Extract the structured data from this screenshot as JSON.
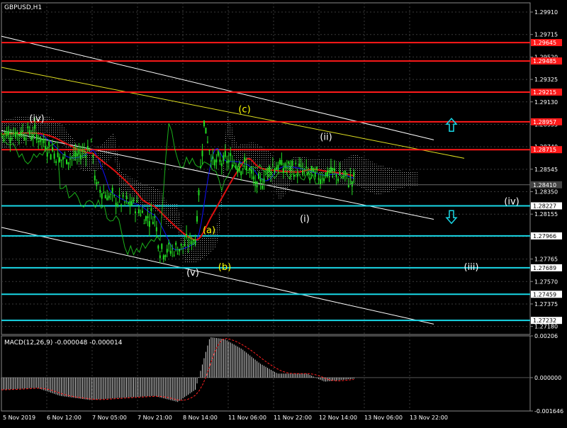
{
  "window": {
    "title": "GBPUSD,H1",
    "macd_label": "MACD(12,26,9) -0.000048 -0.000014"
  },
  "colors": {
    "background": "#000000",
    "grid": "#3a3a3a",
    "price_text": "#ffffff",
    "candle": "#22dd22",
    "resistance_line": "#ff1a1a",
    "support_line": "#19d7e6",
    "slow_ma": "#e01010",
    "fast_ma": "#1010ff",
    "channel_line": "#ffffff",
    "trend_line": "#e0e020",
    "wave_label_white": "#ffffff",
    "wave_label_yellow": "#ffff00",
    "arrow": "#19d7e6",
    "macd_hist": "#d0d0d0",
    "macd_signal": "#ff2020"
  },
  "chart_data": {
    "type": "line",
    "symbol": "GBPUSD",
    "timeframe": "H1",
    "ylim": [
      1.2711,
      1.2999
    ],
    "y_ticks": [
      "1.29910",
      "1.29715",
      "1.29520",
      "1.29325",
      "1.29130",
      "1.28935",
      "1.28740",
      "1.28545",
      "1.28350",
      "1.28155",
      "1.27960",
      "1.27765",
      "1.27570",
      "1.27375",
      "1.27180"
    ],
    "x_ticks": [
      "5 Nov 2019",
      "6 Nov 12:00",
      "7 Nov 05:00",
      "7 Nov 21:00",
      "8 Nov 14:00",
      "11 Nov 06:00",
      "11 Nov 22:00",
      "12 Nov 14:00",
      "13 Nov 06:00",
      "13 Nov 22:00"
    ],
    "current_price": "1.28410",
    "resistance_levels": [
      "1.29645",
      "1.29485",
      "1.29215",
      "1.28957",
      "1.28715"
    ],
    "support_levels": [
      "1.28227",
      "1.27966",
      "1.27689",
      "1.27459",
      "1.27232"
    ],
    "wave_labels": [
      {
        "text": "(iv)",
        "price": 1.2896,
        "color": "white"
      },
      {
        "text": "(c)",
        "price": 1.2904,
        "color": "yellow"
      },
      {
        "text": "(ii)",
        "price": 1.288,
        "color": "white"
      },
      {
        "text": "(a)",
        "price": 1.2799,
        "color": "yellow"
      },
      {
        "text": "(i)",
        "price": 1.2809,
        "color": "white"
      },
      {
        "text": "(b)",
        "price": 1.2767,
        "color": "yellow"
      },
      {
        "text": "(v)",
        "price": 1.2762,
        "color": "white"
      },
      {
        "text": "(iv)",
        "price": 1.2824,
        "color": "white"
      },
      {
        "text": "(iii)",
        "price": 1.2767,
        "color": "white"
      }
    ],
    "macd": {
      "label": "MACD(12,26,9)",
      "main": -4.8e-05,
      "signal": -1.4e-05,
      "y_ticks": [
        "0.00206",
        "0.000000",
        "-0.001646"
      ],
      "ylim": [
        -0.001646,
        0.00206
      ]
    }
  }
}
